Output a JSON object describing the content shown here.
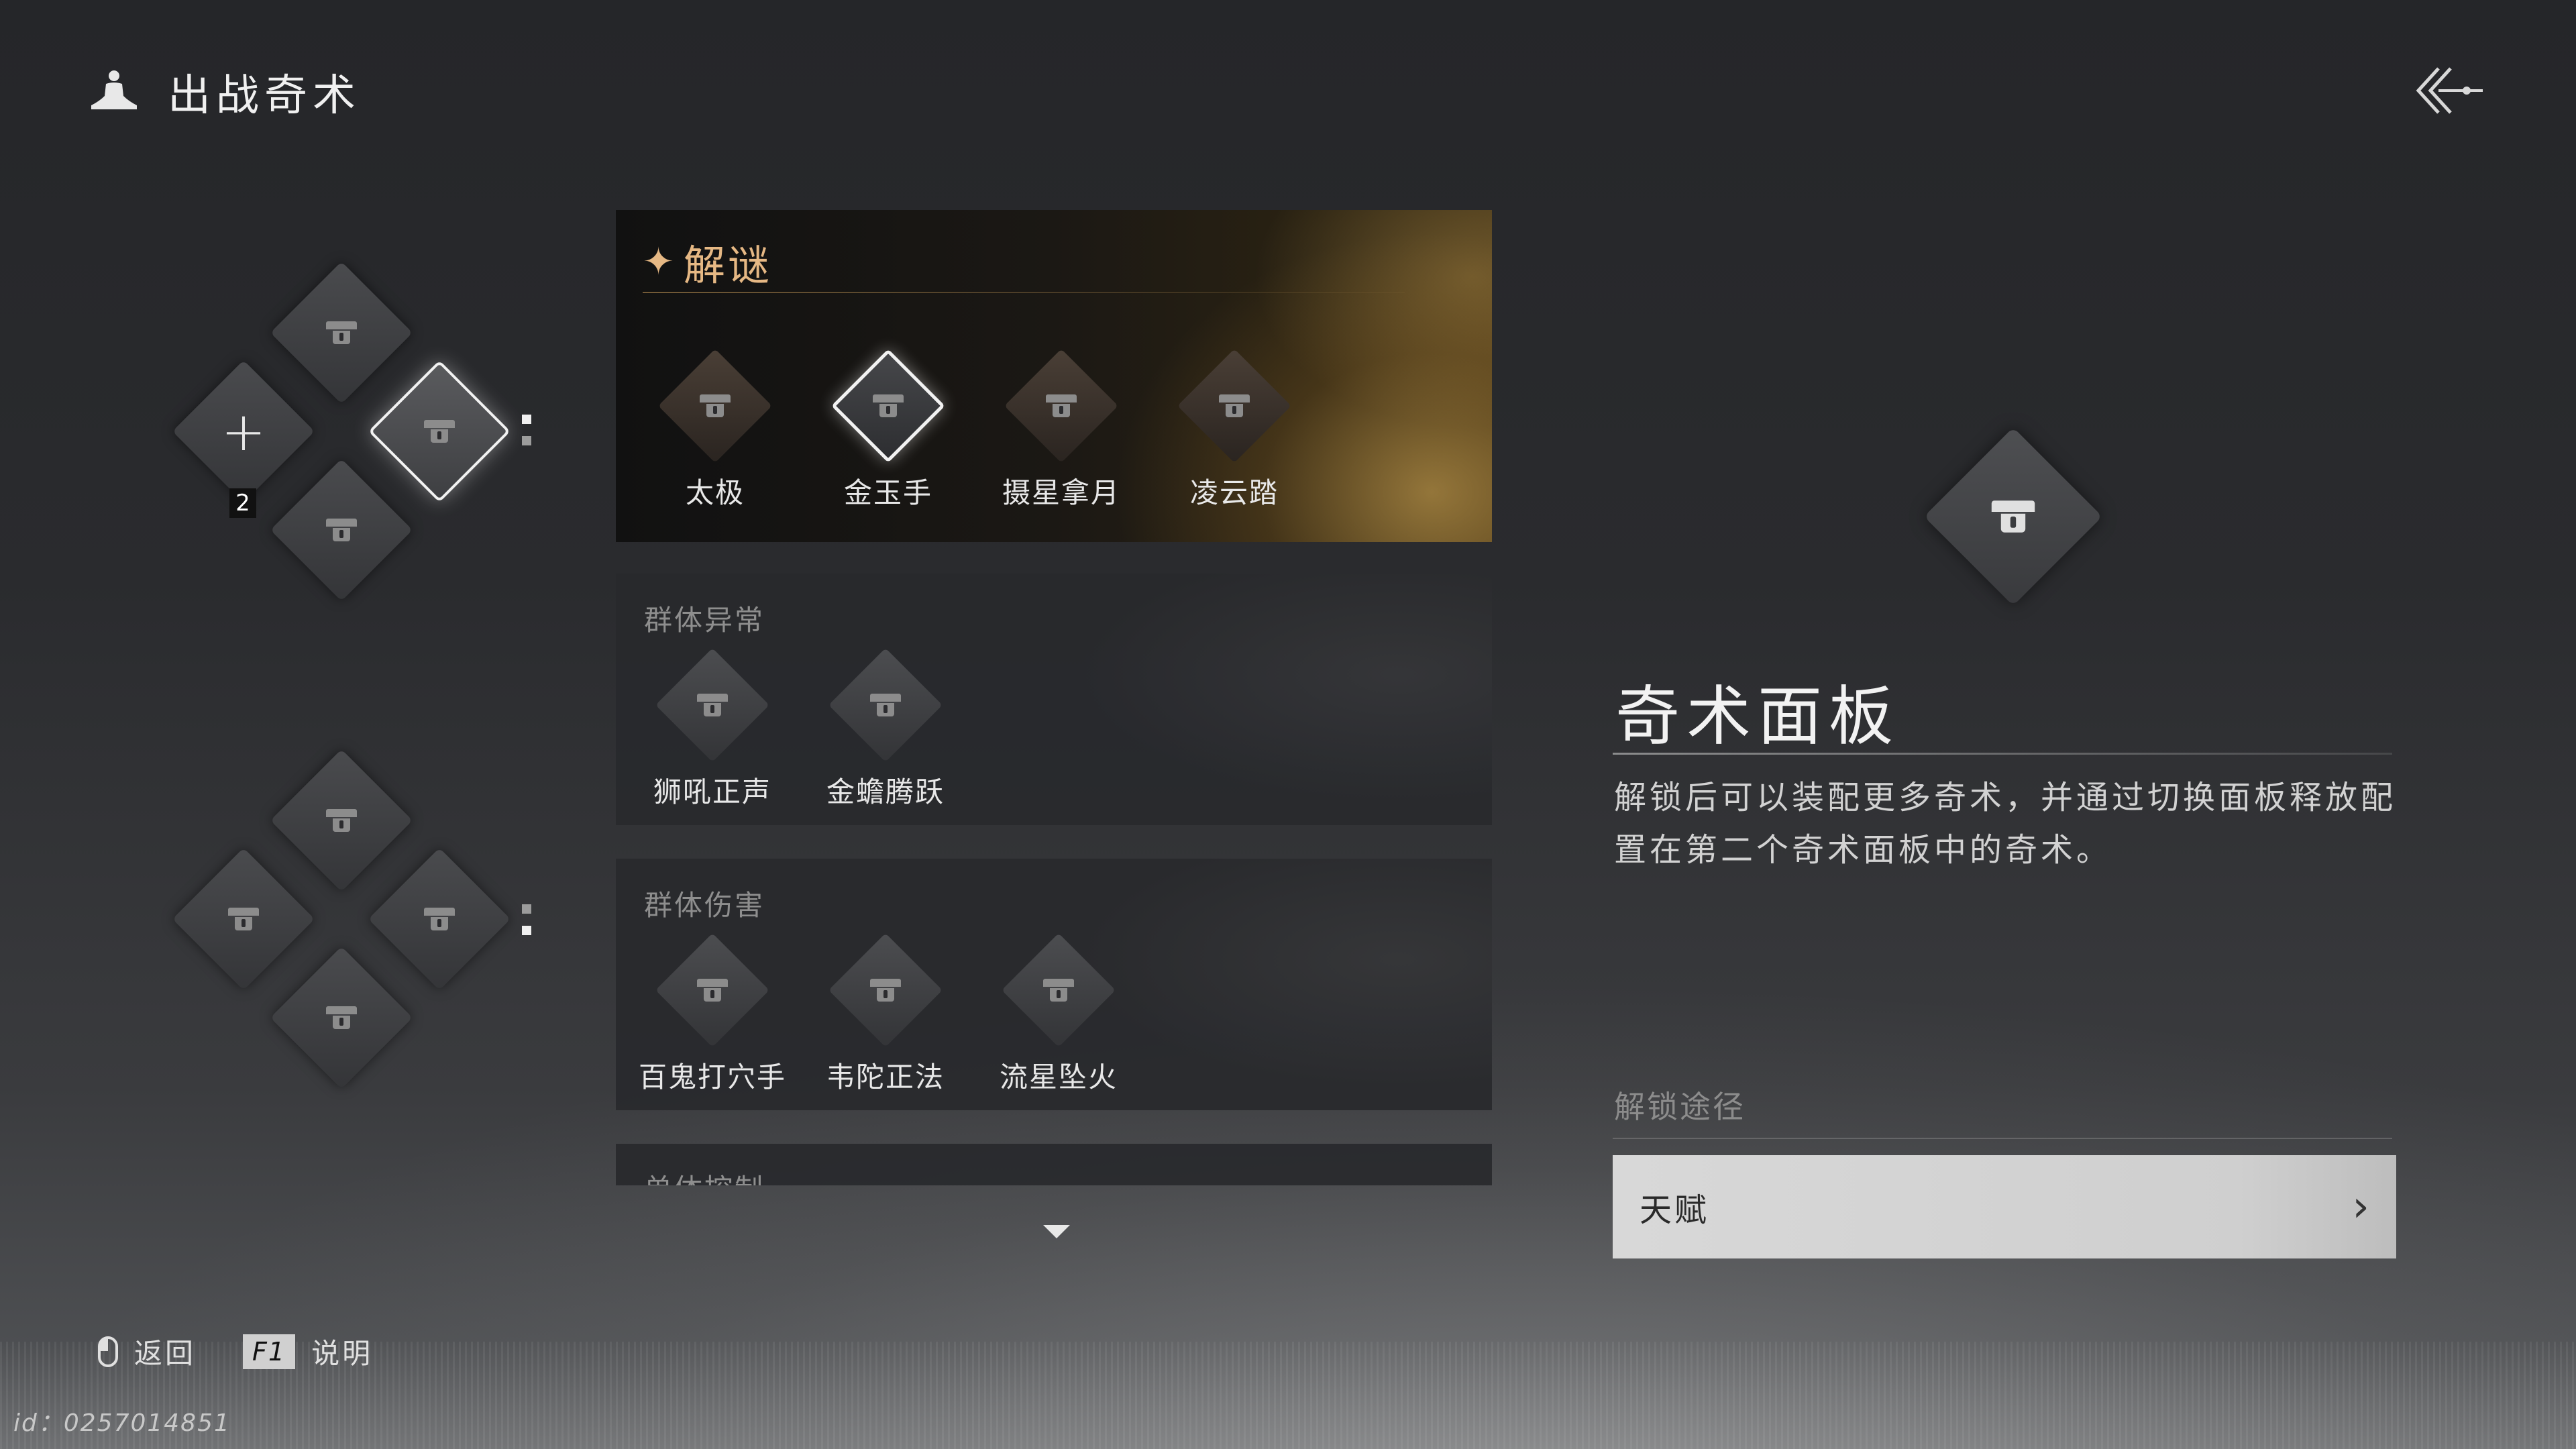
{
  "header": {
    "title": "出战奇术",
    "icon": "meditation-icon"
  },
  "slots": {
    "top_cluster": {
      "add_label": "+",
      "count": "2"
    }
  },
  "panels": {
    "puzzle": {
      "title": "解谜",
      "skills": [
        {
          "name": "太极",
          "selected": false
        },
        {
          "name": "金玉手",
          "selected": true
        },
        {
          "name": "摄星拿月",
          "selected": false
        },
        {
          "name": "凌云踏",
          "selected": false
        }
      ]
    },
    "group_status": {
      "title": "群体异常",
      "skills": [
        {
          "name": "狮吼正声"
        },
        {
          "name": "金蟾腾跃"
        }
      ]
    },
    "group_damage": {
      "title": "群体伤害",
      "skills": [
        {
          "name": "百鬼打穴手"
        },
        {
          "name": "韦陀正法"
        },
        {
          "name": "流星坠火"
        }
      ]
    },
    "single_control": {
      "title": "单体控制"
    }
  },
  "detail": {
    "title": "奇术面板",
    "description": "解锁后可以装配更多奇术，并通过切换面板释放配置在第二个奇术面板中的奇术。",
    "unlock_label": "解锁途径",
    "unlock_option": "天赋",
    "unlock_chevron": "›"
  },
  "footer": {
    "back_label": "返回",
    "help_key": "F1",
    "help_label": "说明",
    "uid": "id：0257014851"
  }
}
